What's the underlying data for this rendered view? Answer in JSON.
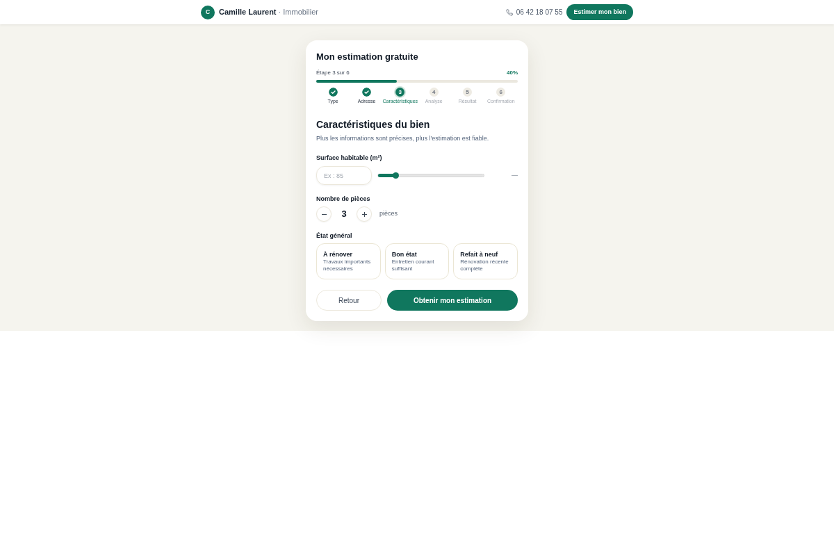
{
  "header": {
    "logo": "C",
    "brand": "Camille Laurent",
    "tagline": "· Immobilier",
    "phone": "06 42 18 07 55",
    "cta": "Estimer mon bien"
  },
  "estimate_card": {
    "title": "Mon estimation gratuite",
    "progress": {
      "step_label": "Étape 3 sur 6",
      "percent": "40%",
      "level": 0.4
    },
    "steps": [
      {
        "label": "Type",
        "done": true,
        "selected": false
      },
      {
        "label": "Adresse",
        "done": true,
        "selected": false
      },
      {
        "number": "3",
        "label": "Caractéristiques",
        "done": false,
        "selected": true
      },
      {
        "number": "4",
        "label": "Analyse",
        "done": false,
        "selected": false
      },
      {
        "number": "5",
        "label": "Résultat",
        "done": false,
        "selected": false
      },
      {
        "number": "6",
        "label": "Confirmation",
        "done": false,
        "selected": false
      }
    ],
    "section_title": "Caractéristiques du bien",
    "section_subtitle": "Plus les informations sont précises, plus l'estimation est fiable.",
    "surface": {
      "label": "Surface habitable (m²)",
      "placeholder": "Ex : 85",
      "slider": {
        "level": 0.17
      },
      "reading": "—"
    },
    "rooms": {
      "label": "Nombre de pièces",
      "value": "3",
      "unit": "pièces"
    },
    "condition": {
      "label": "État général",
      "options": [
        {
          "title": "À rénover",
          "description": "Travaux importants nécessaires",
          "selected": false
        },
        {
          "title": "Bon état",
          "description": "Entretien courant suffisant",
          "selected": false
        },
        {
          "title": "Refait à neuf",
          "description": "Rénovation récente complète",
          "selected": false
        }
      ]
    },
    "buttons": [
      {
        "kind": "secondary",
        "label": "Retour"
      },
      {
        "kind": "primary",
        "label": "Obtenir mon estimation"
      }
    ]
  }
}
